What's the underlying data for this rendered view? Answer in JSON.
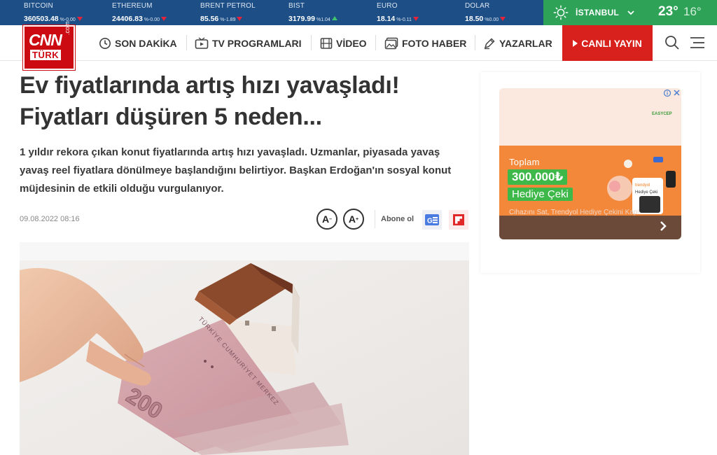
{
  "ticker": [
    {
      "name": "BITCOIN",
      "value": "360503.48",
      "change": "%-0.00",
      "dir": "down"
    },
    {
      "name": "ETHEREUM",
      "value": "24406.83",
      "change": "%-0.00",
      "dir": "down"
    },
    {
      "name": "BRENT PETROL",
      "value": "85.56",
      "change": "%-1.89",
      "dir": "down"
    },
    {
      "name": "BIST",
      "value": "3179.99",
      "change": "%1.04",
      "dir": "up"
    },
    {
      "name": "EURO",
      "value": "18.14",
      "change": "%-0.11",
      "dir": "down"
    },
    {
      "name": "DOLAR",
      "value": "18.50",
      "change": "%0.00",
      "dir": "down"
    }
  ],
  "weather": {
    "city": "İSTANBUL",
    "temp_high": "23°",
    "temp_low": "16°"
  },
  "logo": {
    "cnn": "CNN",
    "turk": "TÜRK",
    "com": ".com"
  },
  "nav": {
    "son_dakika": "SON DAKİKA",
    "tv": "TV PROGRAMLARI",
    "video": "VİDEO",
    "foto": "FOTO HABER",
    "yazarlar": "YAZARLAR",
    "live": "CANLI YAYIN"
  },
  "article": {
    "title": "Ev fiyatlarında artış hızı yavaşladı! Fiyatları düşüren 5 neden...",
    "spot": "1 yıldır rekora çıkan konut fiyatlarında artış hızı yavaşladı. Uzmanlar, piyasada yavaş yavaş reel fiyatlara dönülmeye başlandığını belirtiyor. Başkan Erdoğan'ın sosyal konut müjdesinin de etkili olduğu vurgulanıyor.",
    "date": "09.08.2022 08:16",
    "font_minus": "A",
    "font_plus": "A",
    "subscribe": "Abone ol",
    "banknote_value": "200",
    "banknote_text": "TÜRKİYE CUMHURİYET MERKEZ"
  },
  "ad": {
    "brand": "EASYCEP",
    "total": "Toplam",
    "amount": "300.000₺",
    "gift": "Hediye Çeki",
    "line3": "Cihazını Sat, Trendyol",
    "line4": "Hediye Çekini Kap!",
    "mini_brand": "trendyol",
    "mini_gift": "Hediye Çeki"
  },
  "colors": {
    "ticker_bg": "#1d4f86",
    "weather_bg": "#2ea358",
    "brand_red": "#cc0a12",
    "live_red": "#d8211c"
  }
}
